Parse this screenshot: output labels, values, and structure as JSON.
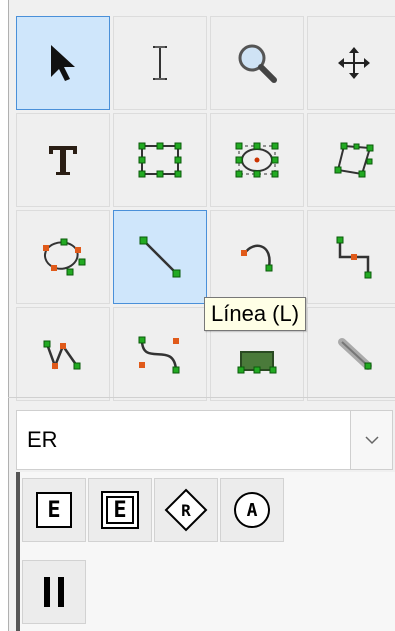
{
  "toolbox": {
    "tools": [
      {
        "name": "pointer",
        "icon": "arrow-pointer-icon",
        "active": true
      },
      {
        "name": "text-cursor",
        "icon": "i-beam-icon",
        "active": false
      },
      {
        "name": "zoom",
        "icon": "magnifier-icon",
        "active": false
      },
      {
        "name": "move",
        "icon": "move-arrows-icon",
        "active": false
      },
      {
        "name": "text",
        "icon": "text-t-icon",
        "active": false
      },
      {
        "name": "box",
        "icon": "box-shape-icon",
        "active": false
      },
      {
        "name": "ellipse",
        "icon": "ellipse-shape-icon",
        "active": false
      },
      {
        "name": "polygon",
        "icon": "polygon-shape-icon",
        "active": false
      },
      {
        "name": "beziergon",
        "icon": "beziergon-shape-icon",
        "active": false
      },
      {
        "name": "line",
        "icon": "line-icon",
        "active": true
      },
      {
        "name": "arc",
        "icon": "arc-icon",
        "active": false
      },
      {
        "name": "zigzag-line",
        "icon": "zigzag-line-icon",
        "active": false
      },
      {
        "name": "polyline",
        "icon": "polyline-icon",
        "active": false
      },
      {
        "name": "bezier-line",
        "icon": "bezier-line-icon",
        "active": false
      },
      {
        "name": "image",
        "icon": "image-icon",
        "active": false
      },
      {
        "name": "outline",
        "icon": "outline-icon",
        "active": false
      }
    ]
  },
  "tooltip": {
    "text": "Línea (L)"
  },
  "sheet_select": {
    "value": "ER"
  },
  "shapes": {
    "items": [
      {
        "label": "E",
        "icon": "entity-icon"
      },
      {
        "label": "E",
        "icon": "weak-entity-icon"
      },
      {
        "label": "R",
        "icon": "relationship-icon"
      },
      {
        "label": "A",
        "icon": "attribute-icon"
      },
      {
        "label": "",
        "icon": "participation-icon"
      }
    ]
  }
}
